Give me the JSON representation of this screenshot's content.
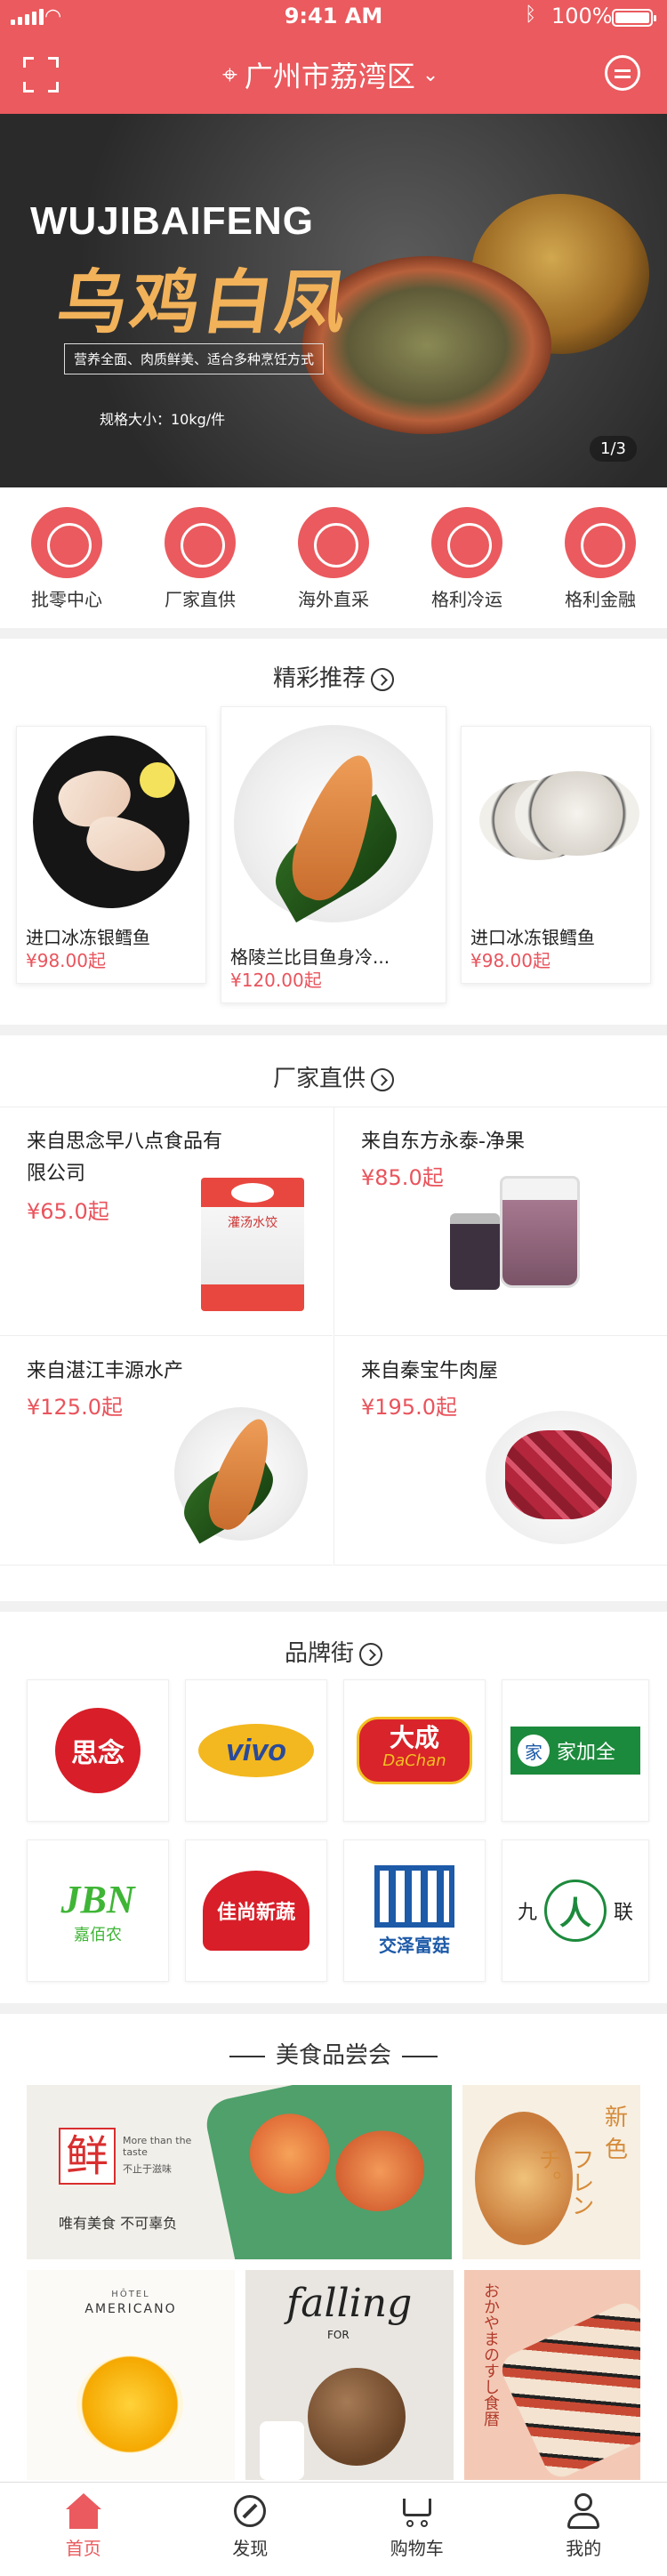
{
  "status_bar": {
    "time": "9:41 AM",
    "battery": "100%"
  },
  "header": {
    "location": "广州市荔湾区"
  },
  "banner": {
    "title_en": "WUJIBAIFENG",
    "title_cn": "乌鸡白凤",
    "tagline": "营养全面、肉质鲜美、适合多种烹饪方式",
    "spec": "规格大小：10kg/件",
    "pager": "1/3"
  },
  "quick_menu": [
    {
      "label": "批零中心",
      "icon": "scale-icon"
    },
    {
      "label": "厂家直供",
      "icon": "factory-icon"
    },
    {
      "label": "海外直采",
      "icon": "plane-icon"
    },
    {
      "label": "格利冷运",
      "icon": "truck-icon"
    },
    {
      "label": "格利金融",
      "icon": "coin-icon"
    }
  ],
  "recommend": {
    "title": "精彩推荐",
    "items": [
      {
        "name": "进口冰冻银鳕鱼",
        "price": "¥98.00起"
      },
      {
        "name": "格陵兰比目鱼身冷...",
        "price": "¥120.00起"
      },
      {
        "name": "进口冰冻银鳕鱼",
        "price": "¥98.00起"
      }
    ]
  },
  "factory": {
    "title": "厂家直供",
    "items": [
      {
        "name": "来自思念早八点食品有限公司",
        "price": "¥65.0起",
        "package_label": "灌汤水饺"
      },
      {
        "name": "来自东方永泰-净果",
        "price": "¥85.0起"
      },
      {
        "name": "来自湛江丰源水产",
        "price": "¥125.0起"
      },
      {
        "name": "来自秦宝牛肉屋",
        "price": "¥195.0起"
      }
    ]
  },
  "brands": {
    "title": "品牌街",
    "items": [
      {
        "name": "思念",
        "color": "#d81e28"
      },
      {
        "name": "vivo",
        "color": "#2a4a9a"
      },
      {
        "name": "大成",
        "sub": "DaChan",
        "color": "#d8242a"
      },
      {
        "name": "家加全",
        "color": "#1c8a3c"
      },
      {
        "name": "JBN",
        "sub": "嘉佰农",
        "color": "#3fb536"
      },
      {
        "name": "佳尚新蔬",
        "color": "#d81e28"
      },
      {
        "name": "交泽富菇",
        "color": "#1d5aa8"
      },
      {
        "name": "九",
        "sub": "联",
        "color": "#1c8a3c"
      }
    ]
  },
  "food_section": {
    "title": "美食品尝会",
    "tile1": {
      "big_char": "鲜",
      "en": "More than the taste",
      "cn_small": "不止于滋味",
      "motto": "唯有美食  不可辜负"
    },
    "tile2": {
      "text_a": "新",
      "text_b": "色",
      "katakana": "フレンチ。"
    },
    "tile3": {
      "brand_top": "HÔTEL",
      "brand": "AMERICANO"
    },
    "tile4": {
      "word": "falling",
      "sub": "FOR"
    },
    "tile5": {
      "jp": "おかやまのすし食暦"
    }
  },
  "tabbar": [
    {
      "label": "首页",
      "icon": "home-icon",
      "active": true
    },
    {
      "label": "发现",
      "icon": "compass-icon"
    },
    {
      "label": "购物车",
      "icon": "cart-icon"
    },
    {
      "label": "我的",
      "icon": "user-icon"
    }
  ],
  "colors": {
    "accent": "#ea5a5e",
    "price": "#e9545d",
    "divider": "#f1f1f1"
  }
}
